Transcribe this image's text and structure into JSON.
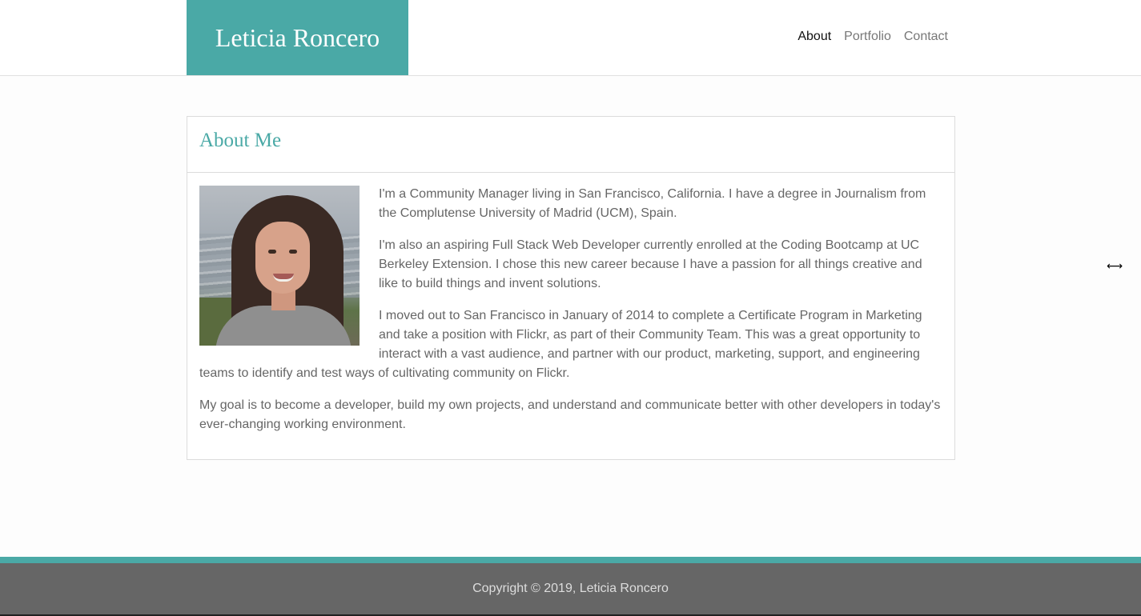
{
  "header": {
    "brand": "Leticia Roncero",
    "brand_color": "#4aa9a6",
    "nav": [
      {
        "label": "About",
        "active": true
      },
      {
        "label": "Portfolio",
        "active": false
      },
      {
        "label": "Contact",
        "active": false
      }
    ]
  },
  "about": {
    "title": "About Me",
    "photo_alt": "profile-photo",
    "paragraphs": [
      "I'm a Community Manager living in San Francisco, California. I have a degree in Journalism from the Complutense University of Madrid (UCM), Spain.",
      "I'm also an aspiring Full Stack Web Developer currently enrolled at the Coding Bootcamp at UC Berkeley Extension. I chose this new career because I have a passion for all things creative and like to build things and invent solutions.",
      "I moved out to San Francisco in January of 2014 to complete a Certificate Program in Marketing and take a position with Flickr, as part of their Community Team. This was a great opportunity to interact with a vast audience, and partner with our product, marketing, support, and engineering teams to identify and test ways of cultivating community on Flickr.",
      "My goal is to become a developer, build my own projects, and understand and communicate better with other developers in today's ever-changing working environment."
    ]
  },
  "cursor": {
    "glyph": "⟷",
    "icon": "resize-horizontal-icon"
  },
  "footer": {
    "copyright": "Copyright © 2019, Leticia Roncero",
    "bg_color": "#666666"
  }
}
